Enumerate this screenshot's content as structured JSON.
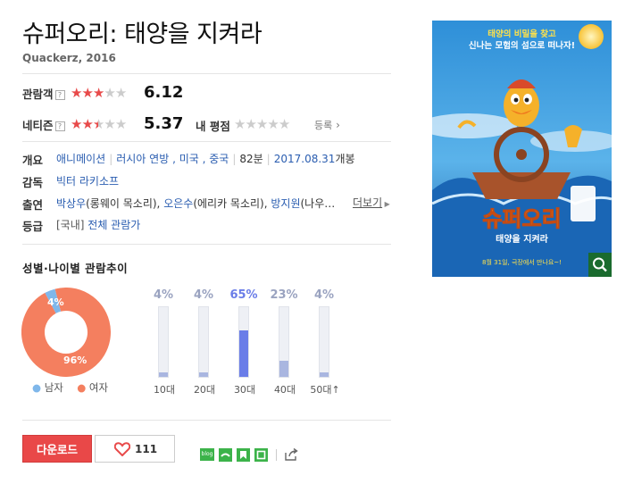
{
  "movie": {
    "title": "슈퍼오리: 태양을 지켜라",
    "subtitle": "Quackerz, 2016"
  },
  "ratings": {
    "audience": {
      "label": "관람객",
      "help": "?",
      "stars": 3,
      "score": "6.12"
    },
    "netizen": {
      "label": "네티즌",
      "help": "?",
      "stars": 2.5,
      "score": "5.37"
    },
    "my_rating": {
      "label": "내 평점",
      "stars": 0,
      "register_label": "등록"
    }
  },
  "info": {
    "overview": {
      "label": "개요",
      "genre": "애니메이션",
      "country": "러시아 연방 , 미국 , 중국",
      "runtime": "82분",
      "release_date": "2017.08.31",
      "release_suffix": "개봉"
    },
    "director": {
      "label": "감독",
      "name": "빅터 라키소프"
    },
    "cast": {
      "label": "출연",
      "actors": [
        {
          "name": "박상우",
          "role": "(롱웨이 목소리)"
        },
        {
          "name": "오은수",
          "role": "(에리카 목소리)"
        },
        {
          "name": "방지원",
          "role": "(나우…"
        }
      ],
      "more_label": "더보기"
    },
    "grade": {
      "label": "등급",
      "prefix": "[국내]",
      "value": "전체 관람가"
    }
  },
  "trend": {
    "title": "성별·나이별 관람추이",
    "gender": {
      "male_pct": 4,
      "female_pct": 96,
      "male_label": "4%",
      "female_label": "96%",
      "legend_male": "남자",
      "legend_female": "여자",
      "male_color": "#7fb7ea",
      "female_color": "#f47f5f"
    },
    "ages": [
      {
        "label": "10대",
        "pct": 4,
        "pct_label": "4%"
      },
      {
        "label": "20대",
        "pct": 4,
        "pct_label": "4%"
      },
      {
        "label": "30대",
        "pct": 65,
        "pct_label": "65%"
      },
      {
        "label": "40대",
        "pct": 23,
        "pct_label": "23%"
      },
      {
        "label": "50대",
        "pct": 4,
        "pct_label": "4%"
      }
    ],
    "age_fifties_suffix": "↑",
    "highlight_color": "#6a7de8",
    "bar_color": "#a9b6e0"
  },
  "poster": {
    "top_text_1": "태양의 비밀을 찾고",
    "top_text_2": "신나는 모험의 섬으로 떠나자!",
    "title": "슈퍼오리",
    "subtitle": "태양을 지켜라",
    "bottom_text": "8월 31일, 극장에서 만나요~!"
  },
  "actions": {
    "download_label": "다운로드",
    "like_count": "111",
    "share_blog_label": "blog"
  },
  "colors": {
    "star_red": "#e84a4a",
    "star_gray": "#cccccc",
    "link_blue": "#2a5db0"
  }
}
